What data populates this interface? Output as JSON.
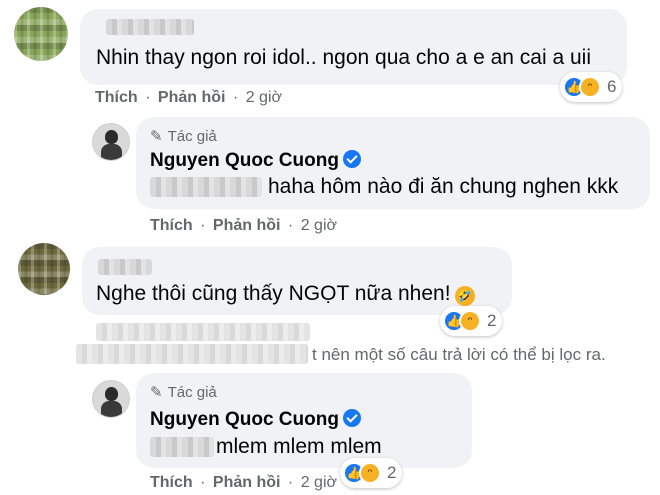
{
  "comments": [
    {
      "text": "Nhin thay ngon roi idol.. ngon qua cho a e an cai a uii",
      "reactions": {
        "count": "6",
        "icons": [
          "like-icon",
          "haha-icon"
        ]
      },
      "actions": {
        "like": "Thích",
        "reply": "Phản hồi",
        "time": "2 giờ",
        "separator": "·"
      }
    },
    {
      "author_tag": "Tác giả",
      "author": "Nguyen Quoc Cuong",
      "text": "haha hôm nào đi ăn chung nghen kkk",
      "actions": {
        "like": "Thích",
        "reply": "Phản hồi",
        "time": "2 giờ",
        "separator": "·"
      }
    },
    {
      "text": "Nghe thôi cũng thấy NGỌT nữa nhen!",
      "emoji": "🤣",
      "reactions": {
        "count": "2",
        "icons": [
          "like-icon",
          "haha-icon"
        ]
      }
    },
    {
      "notice": "t nên một số câu trả lời có thể bị lọc ra."
    },
    {
      "author_tag": "Tác giả",
      "author": "Nguyen Quoc Cuong",
      "text": "mlem mlem mlem",
      "reactions": {
        "count": "2",
        "icons": [
          "like-icon",
          "haha-icon"
        ]
      },
      "actions": {
        "like": "Thích",
        "reply": "Phản hồi",
        "time": "2 giờ",
        "separator": "·"
      }
    }
  ],
  "colors": {
    "bubble": "#f0f2f5",
    "secondary_text": "#65676b",
    "like_blue": "#1877f2",
    "haha_yellow": "#f7b125"
  }
}
